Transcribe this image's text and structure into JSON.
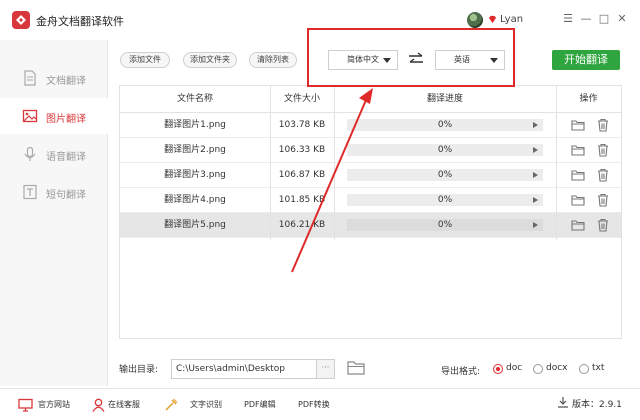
{
  "app": {
    "title": "金舟文档翻译软件",
    "username": "Lyan"
  },
  "window_controls": {
    "menu": "☰",
    "minimize": "—",
    "maximize": "□",
    "close": "✕"
  },
  "sidebar": {
    "items": [
      {
        "label": "文档翻译",
        "icon": "document-icon",
        "active": false
      },
      {
        "label": "图片翻译",
        "icon": "image-icon",
        "active": true
      },
      {
        "label": "语音翻译",
        "icon": "microphone-icon",
        "active": false
      },
      {
        "label": "短句翻译",
        "icon": "text-icon",
        "active": false
      }
    ]
  },
  "toolbar": {
    "add_file": "添加文件",
    "add_folder": "添加文件夹",
    "clear_list": "清除列表",
    "source_lang": "简体中文",
    "target_lang": "英语",
    "start": "开始翻译"
  },
  "table": {
    "headers": {
      "name": "文件名称",
      "size": "文件大小",
      "progress": "翻译进度",
      "actions": "操作"
    },
    "rows": [
      {
        "name": "翻译图片1.png",
        "size": "103.78 KB",
        "progress": "0%",
        "progress_value": 0,
        "selected": false
      },
      {
        "name": "翻译图片2.png",
        "size": "106.33 KB",
        "progress": "0%",
        "progress_value": 0,
        "selected": false
      },
      {
        "name": "翻译图片3.png",
        "size": "106.87 KB",
        "progress": "0%",
        "progress_value": 0,
        "selected": false
      },
      {
        "name": "翻译图片4.png",
        "size": "101.85 KB",
        "progress": "0%",
        "progress_value": 0,
        "selected": false
      },
      {
        "name": "翻译图片5.png",
        "size": "106.21 KB",
        "progress": "0%",
        "progress_value": 0,
        "selected": true
      }
    ]
  },
  "output": {
    "label": "输出目录:",
    "path": "C:\\Users\\admin\\Desktop",
    "browse": "···",
    "format_label": "导出格式:",
    "formats": [
      {
        "label": "doc",
        "selected": true
      },
      {
        "label": "docx",
        "selected": false
      },
      {
        "label": "txt",
        "selected": false
      }
    ]
  },
  "footer": {
    "items": [
      "官方网站",
      "在线客服",
      "文字识别",
      "PDF编辑",
      "PDF转换"
    ],
    "version": "版本：2.9.1"
  },
  "colors": {
    "accent": "#d8383b",
    "start_button": "#2fa53f",
    "annotation": "#e02a2a"
  }
}
